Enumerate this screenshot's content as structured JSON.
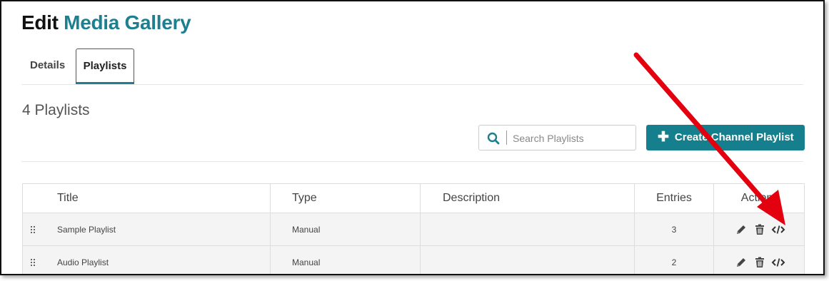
{
  "page": {
    "title_prefix": "Edit",
    "title_name": "Media Gallery"
  },
  "tabs": [
    {
      "label": "Details"
    },
    {
      "label": "Playlists"
    }
  ],
  "playlists_count": "4 Playlists",
  "search": {
    "placeholder": "Search Playlists"
  },
  "create_button": {
    "label": "Create Channel Playlist",
    "icon": "plus-icon"
  },
  "table": {
    "headers": {
      "title": "Title",
      "type": "Type",
      "description": "Description",
      "entries": "Entries",
      "actions": "Actions"
    },
    "rows": [
      {
        "title": "Sample Playlist",
        "type": "Manual",
        "description": "",
        "entries": "3"
      },
      {
        "title": "Audio Playlist",
        "type": "Manual",
        "description": "",
        "entries": "2"
      }
    ],
    "action_icons": [
      "pencil-icon",
      "trash-icon",
      "embed-code-icon"
    ]
  },
  "colors": {
    "accent": "#1d7f8f",
    "button": "#157f8d",
    "annotation_arrow": "#e3000f"
  }
}
